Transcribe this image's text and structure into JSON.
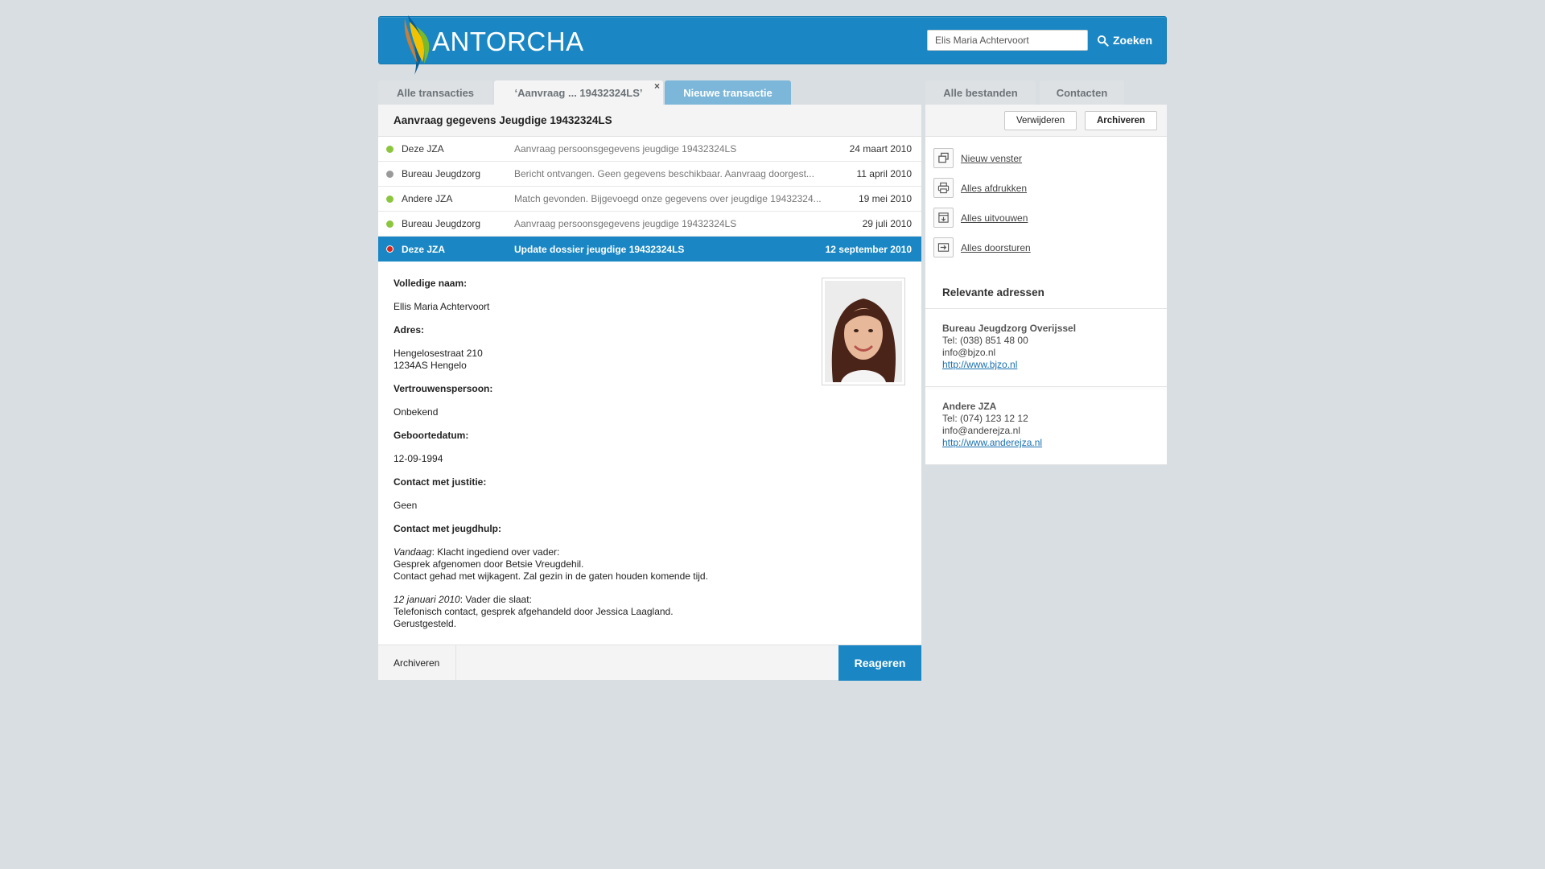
{
  "header": {
    "logo_text": "ANTORCHA",
    "search_value": "Elis Maria Achtervoort",
    "search_button": "Zoeken"
  },
  "tabs": {
    "all_transactions": "Alle transacties",
    "current": "‘Aanvraag ... 19432324LS’",
    "close": "×",
    "new_transaction": "Nieuwe transactie",
    "all_files": "Alle bestanden",
    "contacts": "Contacten"
  },
  "main": {
    "title": "Aanvraag gegevens Jeugdige 19432324LS",
    "delete_button": "Verwijderen",
    "archive_button": "Archiveren",
    "messages": [
      {
        "sender": "Deze JZA",
        "subject": "Aanvraag persoonsgegevens jeugdige 19432324LS",
        "date": "24 maart 2010",
        "status_color": "#8cc63f"
      },
      {
        "sender": "Bureau Jeugdzorg",
        "subject": "Bericht ontvangen. Geen gegevens beschikbaar. Aanvraag doorgest...",
        "date": "11 april 2010",
        "status_color": "#9a9a9a"
      },
      {
        "sender": "Andere JZA",
        "subject": "Match gevonden. Bijgevoegd onze gegevens over jeugdige 19432324...",
        "date": "19 mei 2010",
        "status_color": "#8cc63f"
      },
      {
        "sender": "Bureau Jeugdzorg",
        "subject": "Aanvraag persoonsgegevens jeugdige 19432324LS",
        "date": "29 juli 2010",
        "status_color": "#8cc63f"
      },
      {
        "sender": "Deze JZA",
        "subject": "Update dossier jeugdige 19432324LS",
        "date": "12 september 2010",
        "status_color": "#d9261c"
      }
    ],
    "detail": {
      "name_label": "Volledige naam:",
      "name": "Ellis Maria Achtervoort",
      "address_label": "Adres:",
      "address_line1": "Hengelosestraat 210",
      "address_line2": "1234AS Hengelo",
      "trust_label": "Vertrouwenspersoon:",
      "trust": "Onbekend",
      "birth_label": "Geboortedatum:",
      "birth": "12-09-1994",
      "justice_label": "Contact met justitie:",
      "justice": "Geen",
      "youth_label": "Contact met jeugdhulp:",
      "note1_date": "Vandaag",
      "note1_title": ": Klacht ingediend over vader:",
      "note1_line1": "Gesprek afgenomen door Betsie Vreugdehil.",
      "note1_line2": "Contact gehad met wijkagent. Zal gezin in de gaten houden komende tijd.",
      "note2_date": "12 januari 2010",
      "note2_title": ": Vader die slaat:",
      "note2_line1": "Telefonisch contact, gesprek afgehandeld door Jessica Laagland.",
      "note2_line2": "Gerustgesteld."
    },
    "footer_archive": "Archiveren",
    "footer_reply": "Reageren"
  },
  "side": {
    "actions": [
      {
        "label": "Nieuw venster",
        "icon": "new-window-icon"
      },
      {
        "label": "Alles afdrukken",
        "icon": "print-icon"
      },
      {
        "label": "Alles uitvouwen",
        "icon": "expand-icon"
      },
      {
        "label": "Alles doorsturen",
        "icon": "forward-icon"
      }
    ],
    "heading": "Relevante adressen",
    "addresses": [
      {
        "name": "Bureau Jeugdzorg Overijssel",
        "tel": "Tel: (038) 851 48 00",
        "email": "info@bjzo.nl",
        "url": "http://www.bjzo.nl"
      },
      {
        "name": "Andere JZA",
        "tel": "Tel: (074) 123 12 12",
        "email": "info@anderejza.nl",
        "url": "http://www.anderejza.nl"
      }
    ]
  },
  "colors": {
    "brand_blue": "#1a87c4",
    "background": "#d9dee2"
  }
}
